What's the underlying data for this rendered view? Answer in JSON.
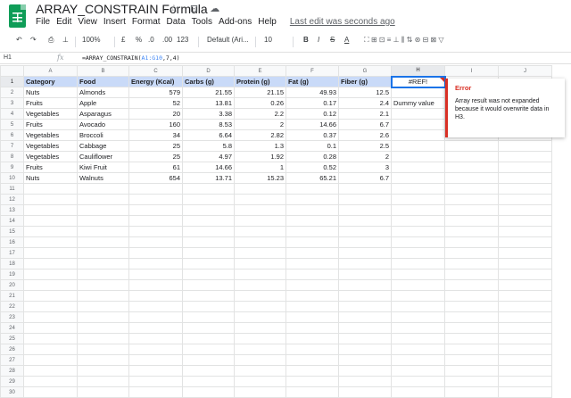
{
  "app": {
    "title": "ARRAY_CONSTRAIN Formula",
    "menu": [
      "File",
      "Edit",
      "View",
      "Insert",
      "Format",
      "Data",
      "Tools",
      "Add-ons",
      "Help"
    ],
    "last_edit": "Last edit was seconds ago",
    "title_icons": "☆ ⊡ ☁"
  },
  "toolbar": {
    "undo": "↶",
    "redo": "↷",
    "print": "⎙",
    "paint": "⊥",
    "zoom": "100%",
    "currency": "£",
    "percent": "%",
    "dec_less": ".0",
    "dec_more": ".00",
    "more_formats": "123",
    "font": "Default (Ari...",
    "font_size": "10",
    "bold": "B",
    "italic": "I",
    "strike": "S",
    "text_color": "A",
    "icons": "⛶  ⊞  ⊡  ≡  ⊥  ⫼  ⇅  ⊛  ⊟  ⊠  ▽"
  },
  "formula_bar": {
    "cell": "H1",
    "fx": "fx",
    "formula_prefix": "=ARRAY_CONSTRAIN(",
    "formula_ref": "A1:G10",
    "formula_suffix": ",7,4)"
  },
  "columns": [
    "A",
    "B",
    "C",
    "D",
    "E",
    "F",
    "G",
    "H",
    "I",
    "J"
  ],
  "rows": [
    [
      "Category",
      "Food",
      "Energy (Kcal)",
      "Carbs (g)",
      "Protein (g)",
      "Fat (g)",
      "Fiber (g)",
      "#REF!",
      "",
      ""
    ],
    [
      "Nuts",
      "Almonds",
      "579",
      "21.55",
      "21.15",
      "49.93",
      "12.5",
      "",
      "",
      ""
    ],
    [
      "Fruits",
      "Apple",
      "52",
      "13.81",
      "0.26",
      "0.17",
      "2.4",
      "Dummy value",
      "",
      ""
    ],
    [
      "Vegetables",
      "Asparagus",
      "20",
      "3.38",
      "2.2",
      "0.12",
      "2.1",
      "",
      "",
      ""
    ],
    [
      "Fruits",
      "Avocado",
      "160",
      "8.53",
      "2",
      "14.66",
      "6.7",
      "",
      "",
      ""
    ],
    [
      "Vegetables",
      "Broccoli",
      "34",
      "6.64",
      "2.82",
      "0.37",
      "2.6",
      "",
      "",
      ""
    ],
    [
      "Vegetables",
      "Cabbage",
      "25",
      "5.8",
      "1.3",
      "0.1",
      "2.5",
      "",
      "",
      ""
    ],
    [
      "Vegetables",
      "Cauliflower",
      "25",
      "4.97",
      "1.92",
      "0.28",
      "2",
      "",
      "",
      ""
    ],
    [
      "Fruits",
      "Kiwi Fruit",
      "61",
      "14.66",
      "1",
      "0.52",
      "3",
      "",
      "",
      ""
    ],
    [
      "Nuts",
      "Walnuts",
      "654",
      "13.71",
      "15.23",
      "65.21",
      "6.7",
      "",
      "",
      ""
    ]
  ],
  "total_rows": 30,
  "error_tooltip": {
    "title": "Error",
    "message": "Array result was not expanded because it would overwrite data in H3."
  },
  "colors": {
    "header_fill": "#c9daf8",
    "error": "#d93025",
    "selection": "#1a73e8"
  }
}
